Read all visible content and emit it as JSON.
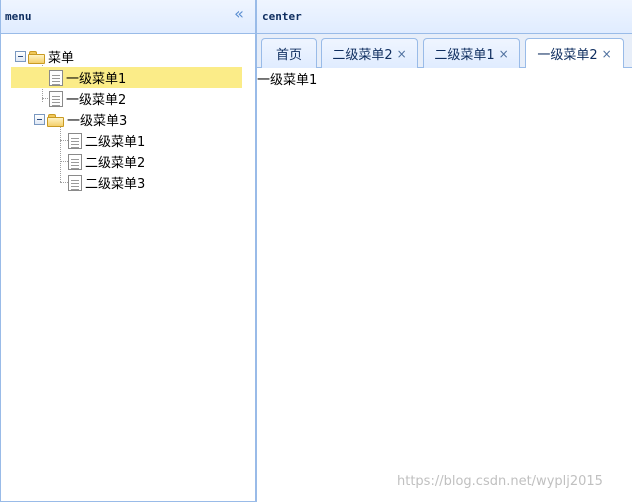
{
  "west": {
    "title": "menu",
    "collapse_icon": "double-chevron-left-icon",
    "collapse_glyph": "«"
  },
  "tree": {
    "root": {
      "label": "菜单"
    },
    "items": [
      {
        "label": "一级菜单1",
        "selected": true
      },
      {
        "label": "一级菜单2",
        "selected": false
      },
      {
        "label": "一级菜单3",
        "selected": false,
        "children": [
          {
            "label": "二级菜单1"
          },
          {
            "label": "二级菜单2"
          },
          {
            "label": "二级菜单3"
          }
        ]
      }
    ]
  },
  "center": {
    "title": "center",
    "tabs": [
      {
        "label": "首页",
        "closable": false
      },
      {
        "label": "二级菜单2",
        "closable": true
      },
      {
        "label": "二级菜单1",
        "closable": true
      },
      {
        "label": "一级菜单2",
        "closable": true
      }
    ],
    "close_glyph": "×",
    "content_text": "一级菜单1"
  },
  "watermark": "https://blog.csdn.net/wyplj2015",
  "colors": {
    "border": "#99bbe8",
    "selected": "#fbec88",
    "header": "#e0ecff"
  }
}
